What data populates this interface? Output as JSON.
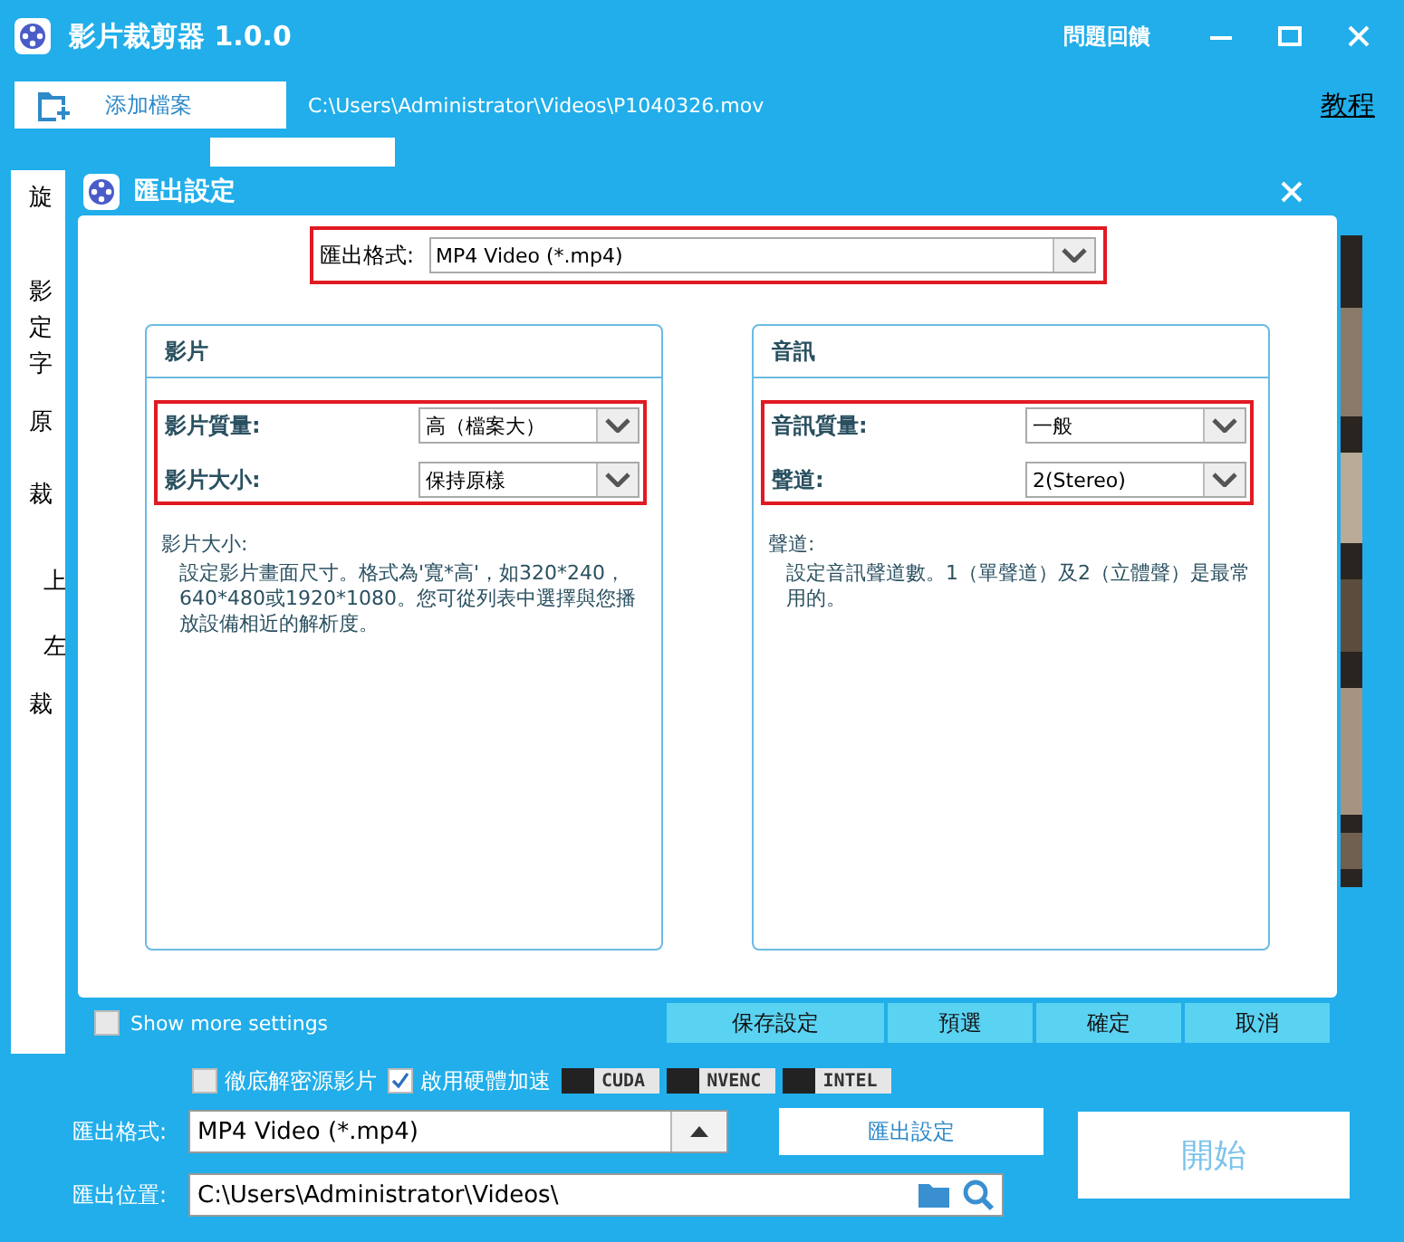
{
  "window": {
    "title": "影片裁剪器 1.0.0",
    "feedback": "問題回饋"
  },
  "toolbar": {
    "add_file": "添加檔案",
    "file_path": "C:\\Users\\Administrator\\Videos\\P1040326.mov",
    "tutorial": "教程"
  },
  "side_panel": {
    "labels": [
      "旋",
      "影",
      "定",
      "字",
      "原",
      "裁",
      "上",
      "左",
      "裁"
    ]
  },
  "dialog": {
    "title": "匯出設定",
    "format": {
      "label": "匯出格式:",
      "value": "MP4 Video (*.mp4)"
    },
    "video": {
      "heading": "影片",
      "fields": [
        {
          "label": "影片質量:",
          "value": "高（檔案大）"
        },
        {
          "label": "影片大小:",
          "value": "保持原樣"
        }
      ],
      "help_title": "影片大小:",
      "help_text": "設定影片畫面尺寸。格式為'寬*高'，如320*240，640*480或1920*1080。您可從列表中選擇與您播放設備相近的解析度。"
    },
    "audio": {
      "heading": "音訊",
      "fields": [
        {
          "label": "音訊質量:",
          "value": "一般"
        },
        {
          "label": "聲道:",
          "value": "2(Stereo)"
        }
      ],
      "help_title": "聲道:",
      "help_text": "設定音訊聲道數。1（單聲道）及2（立體聲）是最常用的。"
    },
    "show_more": {
      "label": "Show more settings",
      "checked": false
    },
    "buttons": [
      "保存設定",
      "預選",
      "確定",
      "取消"
    ]
  },
  "bottom": {
    "options": [
      {
        "label": "徹底解密源影片",
        "checked": false
      },
      {
        "label": "啟用硬體加速",
        "checked": true
      }
    ],
    "accelerators": [
      "CUDA",
      "NVENC",
      "INTEL"
    ],
    "format": {
      "label": "匯出格式:",
      "value": "MP4 Video (*.mp4)"
    },
    "export_settings": "匯出設定",
    "location": {
      "label": "匯出位置:",
      "value": "C:\\Users\\Administrator\\Videos\\"
    },
    "start": "開始"
  }
}
